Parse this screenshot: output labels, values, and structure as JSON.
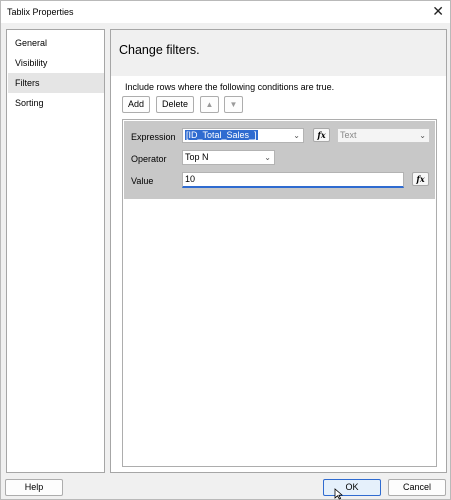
{
  "window": {
    "title": "Tablix Properties",
    "close_glyph": "✕"
  },
  "sidebar": {
    "items": [
      {
        "label": "General",
        "selected": false
      },
      {
        "label": "Visibility",
        "selected": false
      },
      {
        "label": "Filters",
        "selected": true
      },
      {
        "label": "Sorting",
        "selected": false
      }
    ]
  },
  "main": {
    "heading": "Change filters.",
    "instructions": "Include rows where the following conditions are true.",
    "toolbar": {
      "add_label": "Add",
      "delete_label": "Delete",
      "move_up_icon": "▲",
      "move_down_icon": "▼"
    },
    "filter": {
      "expression_label": "Expression",
      "expression_value": "[ID_Total_Sales_]",
      "type_value": "Text",
      "operator_label": "Operator",
      "operator_value": "Top N",
      "value_label": "Value",
      "value_value": "10",
      "fx_label": "fx"
    }
  },
  "footer": {
    "help_label": "Help",
    "ok_label": "OK",
    "cancel_label": "Cancel"
  },
  "icons": {
    "close": "close-icon",
    "fx": "function-icon",
    "arrow_up": "arrow-up-icon",
    "arrow_down": "arrow-down-icon",
    "dropdown": "chevron-down-icon"
  },
  "colors": {
    "accent": "#2f6bd0",
    "selected_row": "#c8c8c8",
    "nav_selected": "#e5e5e5"
  }
}
